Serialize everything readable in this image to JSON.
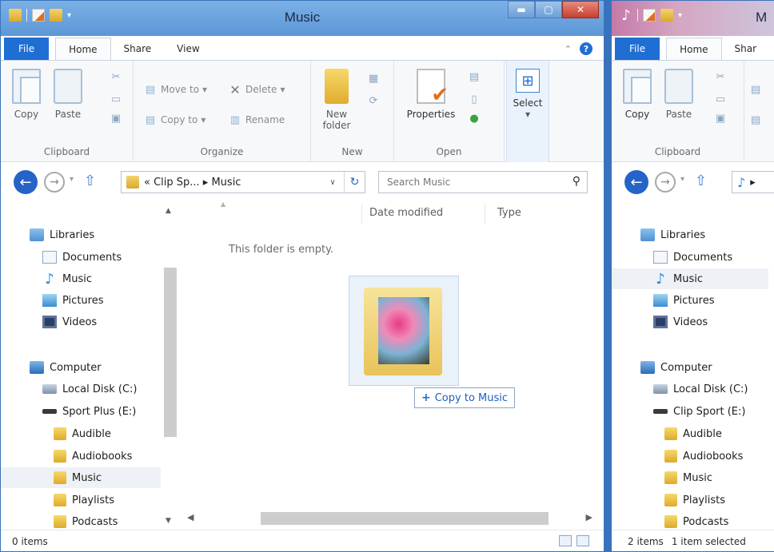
{
  "left": {
    "title": "Music",
    "tabs": [
      "File",
      "Home",
      "Share",
      "View"
    ],
    "clipboard": {
      "copy": "Copy",
      "paste": "Paste",
      "label": "Clipboard"
    },
    "organize": {
      "move_to": "Move to",
      "copy_to": "Copy to",
      "delete": "Delete",
      "rename": "Rename",
      "label": "Organize"
    },
    "new": {
      "new_folder": "New folder",
      "label": "New"
    },
    "open": {
      "properties": "Properties",
      "label": "Open"
    },
    "select": {
      "label": "Select"
    },
    "address": "« Clip Sp... ▸ Music",
    "search_placeholder": "Search Music",
    "nav": [
      "Libraries",
      "Documents",
      "Music",
      "Pictures",
      "Videos",
      "Computer",
      "Local Disk (C:)",
      "Sport Plus (E:)",
      "Audible",
      "Audiobooks",
      "Music",
      "Playlists",
      "Podcasts"
    ],
    "columns": {
      "date": "Date modified",
      "type": "Type"
    },
    "empty_text": "This folder is empty.",
    "drag_tip": "Copy to Music",
    "status": "0 items"
  },
  "right": {
    "title": "M",
    "tabs": [
      "File",
      "Home",
      "Shar"
    ],
    "clipboard": {
      "copy": "Copy",
      "paste": "Paste",
      "label": "Clipboard"
    },
    "nav": [
      "Libraries",
      "Documents",
      "Music",
      "Pictures",
      "Videos",
      "Computer",
      "Local Disk (C:)",
      "Clip Sport (E:)",
      "Audible",
      "Audiobooks",
      "Music",
      "Playlists",
      "Podcasts"
    ],
    "status_items": "2 items",
    "status_selected": "1 item selected"
  },
  "colors": {
    "accent": "#1f6ed4",
    "titlebar": "#6aa3df",
    "close": "#c7402d",
    "folder": "#e0ad2f"
  }
}
